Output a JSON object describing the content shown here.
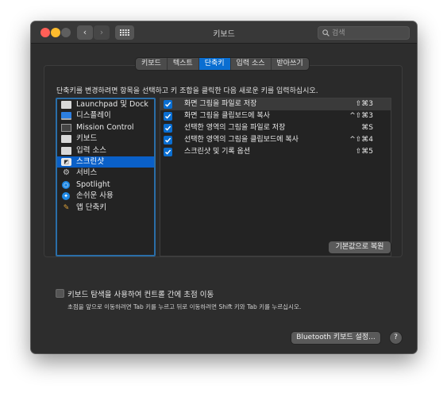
{
  "window": {
    "title": "키보드"
  },
  "search": {
    "placeholder": "검색"
  },
  "tabs": [
    {
      "label": "키보드",
      "active": false
    },
    {
      "label": "텍스트",
      "active": false
    },
    {
      "label": "단축키",
      "active": true
    },
    {
      "label": "입력 소스",
      "active": false
    },
    {
      "label": "받아쓰기",
      "active": false
    }
  ],
  "instruction": "단축키를 변경하려면 항목을 선택하고 키 조합을 클릭한 다음 새로운 키를 입력하십시오.",
  "categories": [
    {
      "label": "Launchpad 및 Dock",
      "icon": "launchpad-dock-icon",
      "selected": false
    },
    {
      "label": "디스플레이",
      "icon": "display-icon",
      "selected": false
    },
    {
      "label": "Mission Control",
      "icon": "mission-control-icon",
      "selected": false
    },
    {
      "label": "키보드",
      "icon": "keyboard-icon",
      "selected": false
    },
    {
      "label": "입력 소스",
      "icon": "input-sources-icon",
      "selected": false
    },
    {
      "label": "스크린샷",
      "icon": "screenshot-icon",
      "selected": true
    },
    {
      "label": "서비스",
      "icon": "services-gear-icon",
      "selected": false
    },
    {
      "label": "Spotlight",
      "icon": "spotlight-icon",
      "selected": false
    },
    {
      "label": "손쉬운 사용",
      "icon": "accessibility-icon",
      "selected": false
    },
    {
      "label": "앱 단축키",
      "icon": "app-shortcuts-icon",
      "selected": false
    }
  ],
  "shortcuts": [
    {
      "label": "화면 그림을 파일로 저장",
      "key": "⇧⌘3",
      "checked": true
    },
    {
      "label": "화면 그림을 클립보드에 복사",
      "key": "^⇧⌘3",
      "checked": true
    },
    {
      "label": "선택한 영역의 그림을 파일로 저장",
      "key": "⌘S",
      "checked": true
    },
    {
      "label": "선택한 영역의 그림을 클립보드에 복사",
      "key": "^⇧⌘4",
      "checked": true
    },
    {
      "label": "스크린샷 및 기록 옵션",
      "key": "⇧⌘5",
      "checked": true
    }
  ],
  "buttons": {
    "restore_defaults": "기본값으로 복원",
    "bluetooth": "Bluetooth 키보드 설정...",
    "help": "?"
  },
  "full_keyboard_access": {
    "label": "키보드 탐색을 사용하여 컨트롤 간에 초점 이동",
    "checked": false,
    "description": "초점을 앞으로 이동하려면 Tab 키를 누르고 뒤로 이동하려면 Shift 키와 Tab 키를 누르십시오."
  },
  "colors": {
    "accent": "#0a6ed1",
    "window_bg": "#2d2d2d",
    "list_bg": "#232323"
  }
}
